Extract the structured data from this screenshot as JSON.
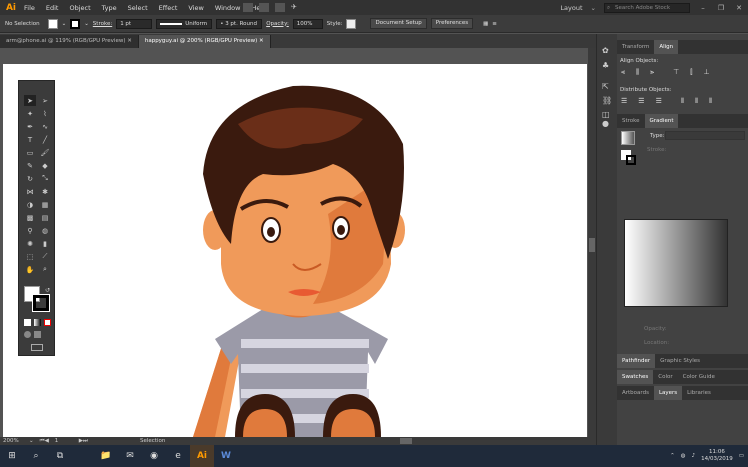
{
  "app": {
    "logo": "Ai",
    "accent": "#ff9a00"
  },
  "menubar": {
    "items": [
      "File",
      "Edit",
      "Object",
      "Type",
      "Select",
      "Effect",
      "View",
      "Window",
      "Help"
    ],
    "workspace": "Layout",
    "search_placeholder": "Search Adobe Stock"
  },
  "control": {
    "selection": "No Selection",
    "stroke_label": "Stroke:",
    "stroke_value": "1 pt",
    "profile": "Uniform",
    "brush": "3 pt. Round",
    "opacity_label": "Opacity:",
    "opacity_value": "100%",
    "style_label": "Style:",
    "doc_setup": "Document Setup",
    "prefs": "Preferences"
  },
  "tabs": [
    {
      "label": "arm@phone.ai @ 119% (RGB/GPU Preview)"
    },
    {
      "label": "happyguy.ai @ 200% (RGB/GPU Preview)"
    }
  ],
  "status": {
    "zoom": "200%",
    "artboard": "1",
    "tool": "Selection"
  },
  "panels": {
    "top_tabs": [
      "Transform",
      "Align"
    ],
    "align_objects": "Align Objects:",
    "distribute_objects": "Distribute Objects:",
    "mid_tabs": [
      "Stroke",
      "Gradient"
    ],
    "type_label": "Type:",
    "stroke_label": "Stroke:",
    "opacity_label": "Opacity:",
    "location_label": "Location:",
    "group1": [
      "Pathfinder",
      "Graphic Styles"
    ],
    "group2": [
      "Swatches",
      "Color",
      "Color Guide"
    ],
    "group3": [
      "Artboards",
      "Layers",
      "Libraries"
    ]
  },
  "taskbar": {
    "time": "11:06",
    "date": "14/03/2019"
  }
}
